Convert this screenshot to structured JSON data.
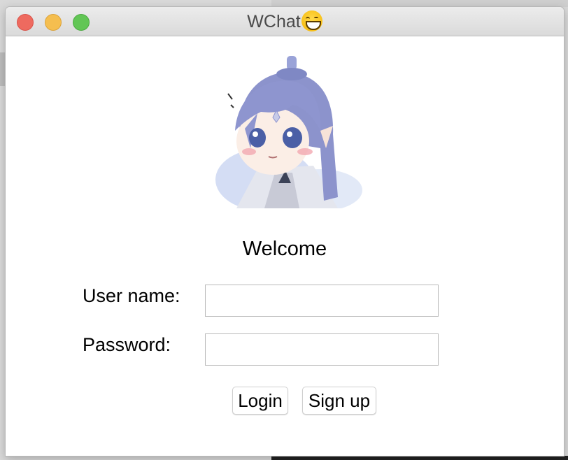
{
  "window": {
    "title": "WChat",
    "title_icon": "grinning-face-emoji"
  },
  "avatar": {
    "icon": "anime-character-avatar"
  },
  "login_form": {
    "welcome_text": "Welcome",
    "username_label": "User name:",
    "username_value": "",
    "password_label": "Password:",
    "password_value": "",
    "login_button": "Login",
    "signup_button": "Sign up"
  },
  "colors": {
    "close": "#ee6a5f",
    "minimize": "#f5be4f",
    "zoom": "#62c655"
  }
}
